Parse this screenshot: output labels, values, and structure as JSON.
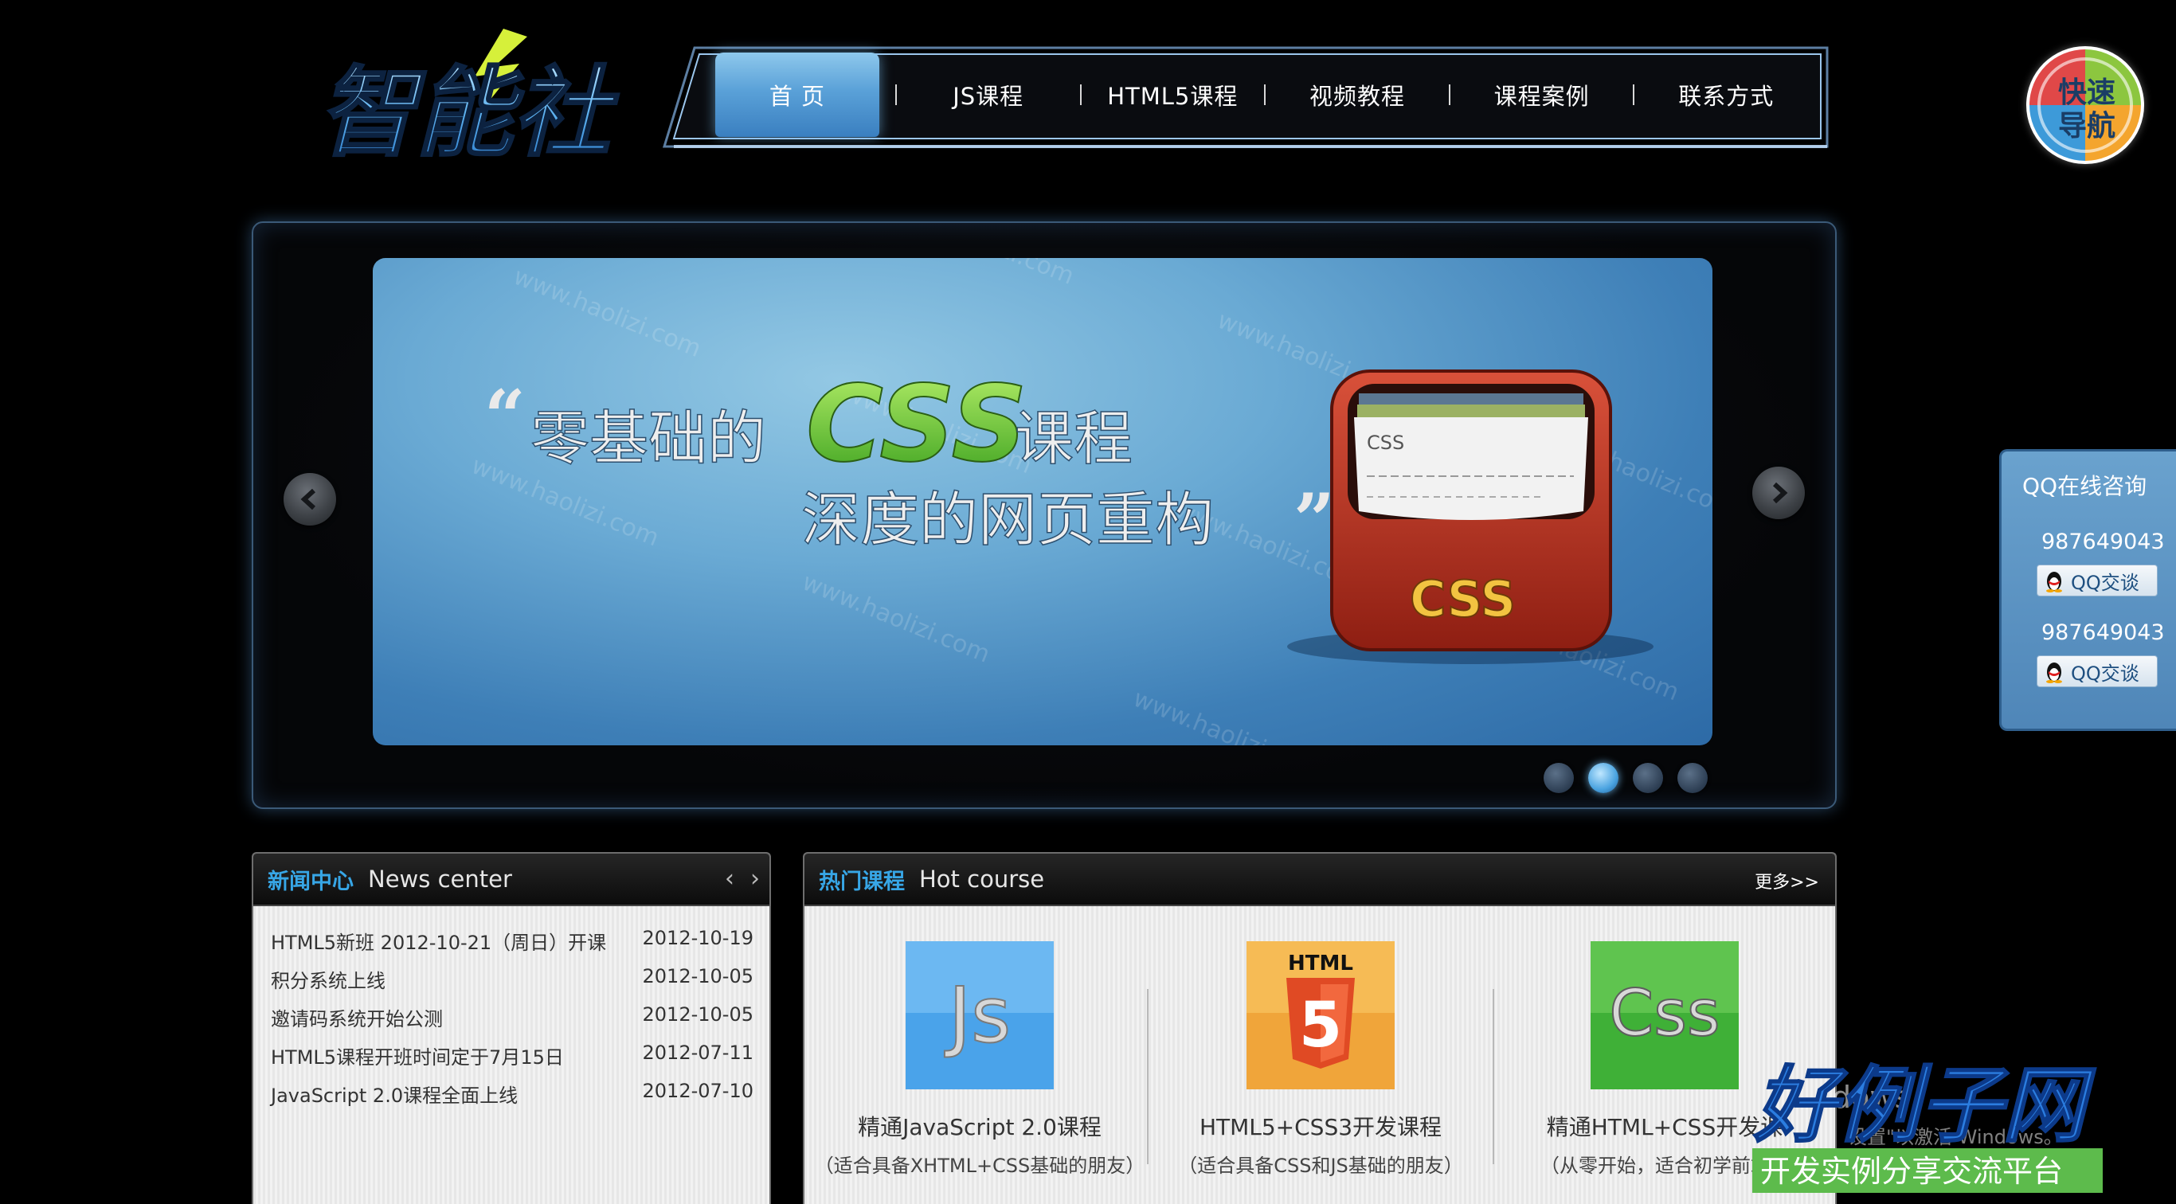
{
  "brand": {
    "logo_text": "智能社"
  },
  "nav": {
    "items": [
      {
        "label": "首 页"
      },
      {
        "label": "JS课程"
      },
      {
        "label": "HTML5课程"
      },
      {
        "label": "视频教程"
      },
      {
        "label": "课程案例"
      },
      {
        "label": "联系方式"
      }
    ],
    "active_index": 0
  },
  "quick_nav": {
    "line1": "快速",
    "line2": "导航",
    "chars": [
      "快",
      "速",
      "导",
      "航"
    ]
  },
  "banner": {
    "headline_1": "零基础的",
    "headline_css": "CSS",
    "headline_2": "课程",
    "headline_3": "深度的网页重构",
    "card_label": "CSS",
    "box_label": "CSS",
    "watermark": "www.haolizi.com",
    "slide_count": 4,
    "active_slide": 1
  },
  "qq": {
    "title": "QQ在线咨询",
    "contacts": [
      {
        "number": "987649043",
        "button": "QQ交谈"
      },
      {
        "number": "987649043",
        "button": "QQ交谈"
      }
    ]
  },
  "news": {
    "title_cn": "新闻中心",
    "title_en": "News center",
    "prev": "‹",
    "next": "›",
    "rows": [
      {
        "title": "HTML5新班 2012-10-21（周日）开课",
        "date": "2012-10-19"
      },
      {
        "title": "积分系统上线",
        "date": "2012-10-05"
      },
      {
        "title": "邀请码系统开始公测",
        "date": "2012-10-05"
      },
      {
        "title": "HTML5课程开班时间定于7月15日",
        "date": "2012-07-11"
      },
      {
        "title": "JavaScript 2.0课程全面上线",
        "date": "2012-07-10"
      }
    ]
  },
  "hot": {
    "title_cn": "热门课程",
    "title_en": "Hot course",
    "more": "更多>>",
    "courses": [
      {
        "icon_label": "Js",
        "title": "精通JavaScript 2.0课程",
        "sub": "（适合具备XHTML+CSS基础的朋友）",
        "color": "#4aa3ea"
      },
      {
        "icon_label": "HTML",
        "icon_num": "5",
        "title": "HTML5+CSS3开发课程",
        "sub": "（适合具备CSS和JS基础的朋友）",
        "color": "#f0a53a"
      },
      {
        "icon_label": "Css",
        "title": "精通HTML+CSS开发课",
        "sub": "（从零开始，适合初学前端的",
        "color": "#3fb037"
      }
    ]
  },
  "overlay": {
    "windows_text": "dows",
    "windows_sub": "设置\"以激活 Windows。",
    "stamp_main": "好例子网",
    "stamp_sub": "开发实例分享交流平台"
  },
  "colors": {
    "accent": "#37a6e6",
    "nav_active": "#5aa1d8",
    "qq_panel": "#5a8fc0"
  }
}
